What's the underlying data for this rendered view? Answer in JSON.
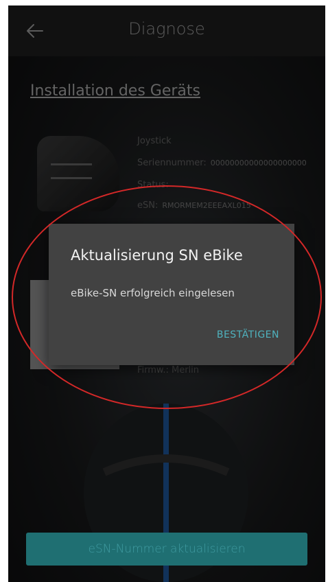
{
  "appbar": {
    "title": "Diagnose",
    "back_icon": "arrow-left-icon"
  },
  "section": {
    "title": "Installation des Geräts"
  },
  "device": {
    "name": "Joystick",
    "serial_label": "Seriennummer:",
    "serial_value": "00000000000000000000",
    "status_label": "Status:",
    "esn_label": "eSN:",
    "esn_value": "RMORMEM2EEEAXL015",
    "firmware_label": "Firmw.:",
    "firmware_value": "Merlin"
  },
  "dialog": {
    "title": "Aktualisierung SN eBike",
    "message": "eBike-SN erfolgreich eingelesen",
    "confirm_label": "BESTÄTIGEN"
  },
  "bottom": {
    "button_label": "eSN-Nummer aktualisieren"
  },
  "colors": {
    "accent": "#4fb3bf",
    "annotation": "#d42828",
    "dialog_bg": "#424242"
  }
}
